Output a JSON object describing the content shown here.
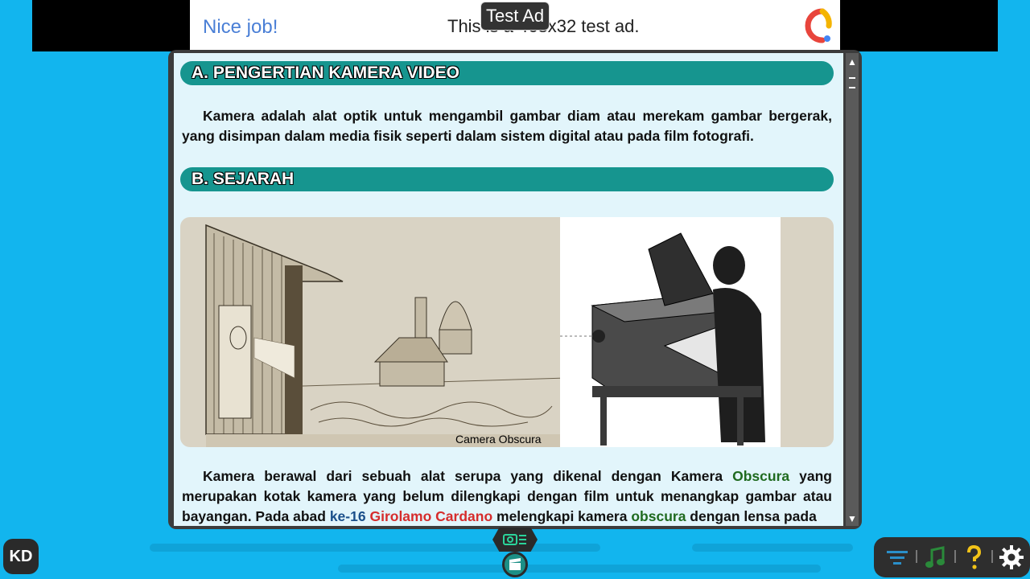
{
  "ad": {
    "nice_text": "Nice job!",
    "body_text": "This is a 468x32 test ad.",
    "badge": "Test Ad",
    "logo_icon": "admob-logo-icon"
  },
  "section_a": {
    "heading": "A. PENGERTIAN KAMERA VIDEO",
    "paragraph": "Kamera adalah alat optik untuk mengambil gambar diam atau merekam gambar bergerak, yang disimpan dalam media fisik seperti dalam sistem digital atau pada film fotografi."
  },
  "section_b": {
    "heading": "B. SEJARAH",
    "image_caption": "Camera Obscura",
    "p_start": "Kamera berawal dari sebuah alat serupa yang dikenal dengan Kamera",
    "term_obscura": "Obscura",
    "p_mid1": "yang merupakan kotak kamera yang belum dilengkapi dengan film untuk menangkap gambar atau bayangan. Pada abad",
    "term_century": "ke-16",
    "term_person": "Girolamo Cardano",
    "p_mid2": "melengkapi kamera",
    "term_obscura2": "obscura",
    "p_end": "dengan lensa pada"
  },
  "bottom": {
    "kd_label": "KD",
    "toolbar_icons": [
      "menu-filter-icon",
      "music-note-icon",
      "help-question-icon",
      "settings-gear-icon"
    ],
    "center_icons": [
      "camera-list-icon",
      "film-clapper-icon"
    ]
  },
  "colors": {
    "background": "#12b5ee",
    "heading_bar": "#16958f",
    "term_green": "#1f6a1f",
    "term_blue": "#1a4f8a",
    "term_red": "#d62c2c"
  }
}
